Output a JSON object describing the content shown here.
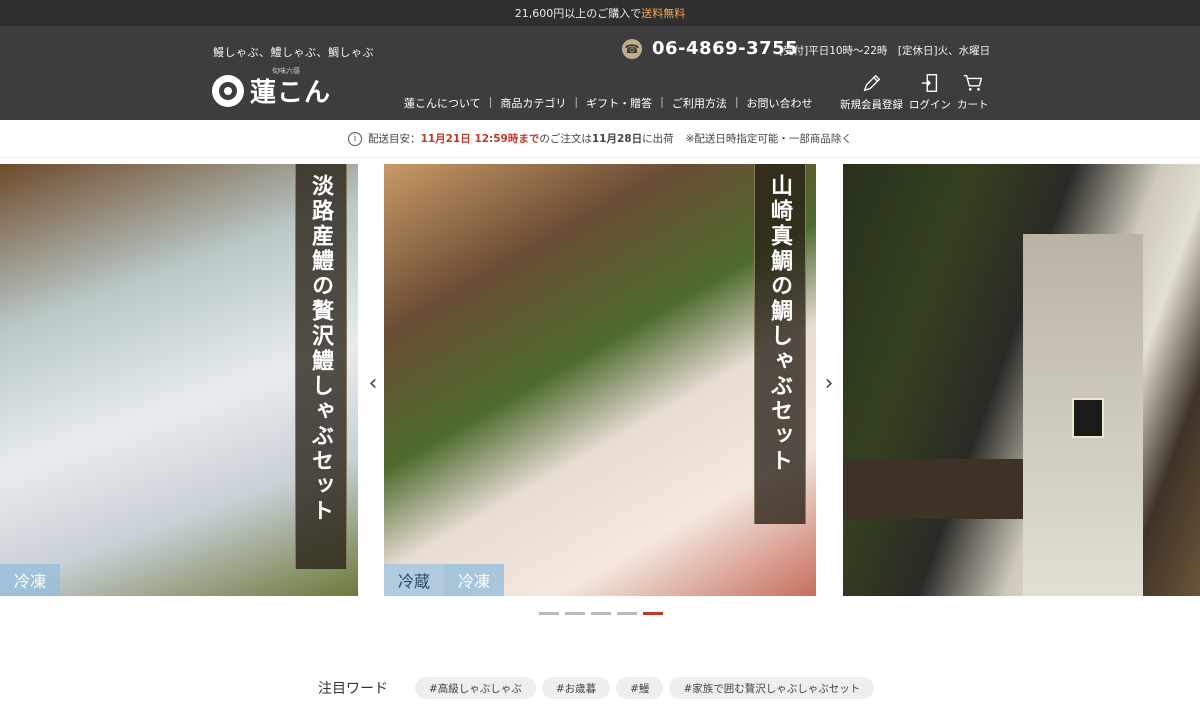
{
  "promo": {
    "text_prefix": "21,600円以上のご購入で",
    "text_highlight": "送料無料"
  },
  "header": {
    "tagline": "鰻しゃぶ、鱧しゃぶ、鯛しゃぶ",
    "logo_text": "蓮こん",
    "logo_sub": "旬味六感",
    "phone_number": "06-4869-3755",
    "hours": "[受付]平日10時～22時　[定休日]火、水曜日",
    "nav": [
      "蓮こんについて",
      "商品カテゴリ",
      "ギフト・贈答",
      "ご利用方法",
      "お問い合わせ"
    ],
    "utility": [
      {
        "label": "新規会員登録",
        "icon": "pencil-icon"
      },
      {
        "label": "ログイン",
        "icon": "login-door-icon"
      },
      {
        "label": "カート",
        "icon": "cart-icon"
      }
    ]
  },
  "notice": {
    "prefix": "配送目安：",
    "deadline": "11月21日 12:59時まで",
    "middle": "のご注文は",
    "ship_date": "11月28日",
    "suffix": "に出荷",
    "note": "※配送日時指定可能・一部商品除く"
  },
  "carousel": {
    "slides": [
      {
        "title": "淡路産鱧の贅沢鱧しゃぶセット",
        "badges": [
          "冷凍"
        ]
      },
      {
        "title": "山崎真鯛の鯛しゃぶセット",
        "badges": [
          "冷蔵",
          "冷凍"
        ]
      },
      {
        "title": "",
        "badges": []
      }
    ],
    "prev_label": "‹",
    "next_label": "›",
    "dot_count": 5,
    "active_dot": 5
  },
  "keywords": {
    "label": "注目ワード",
    "tags": [
      "#高級しゃぶしゃぶ",
      "#お歳暮",
      "#鰻",
      "#家族で囲む贅沢しゃぶしゃぶセット"
    ]
  },
  "colors": {
    "header_bg": "#3d3d3d",
    "promo_bg": "#2f2f2f",
    "accent_red": "#c0392b",
    "promo_highlight": "#f0a85a"
  }
}
